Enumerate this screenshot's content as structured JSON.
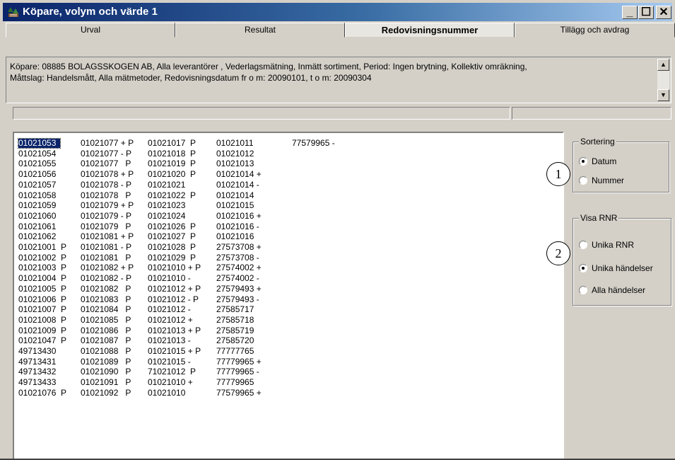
{
  "window": {
    "title": "Köpare, volym och värde 1",
    "icon": "forest-app-icon",
    "buttons": [
      {
        "name": "minimize",
        "icon": "minimize-icon",
        "glyph": "_"
      },
      {
        "name": "maximize",
        "icon": "maximize-icon",
        "glyph": "☐"
      },
      {
        "name": "close",
        "icon": "close-icon",
        "glyph": "✕"
      }
    ]
  },
  "tabs": [
    {
      "label": "Urval",
      "active": false
    },
    {
      "label": "Resultat",
      "active": false
    },
    {
      "label": "Redovisningsnummer",
      "active": true
    },
    {
      "label": "Tillägg och avdrag",
      "active": false
    }
  ],
  "info": {
    "line1": "Köpare: 08885 BOLAGSSKOGEN AB, Alla leverantörer , Vederlagsmätning, Inmätt sortiment, Period: Ingen brytning, Kollektiv omräkning,",
    "line2": "Måttslag: Handelsmått, Alla mätmetoder, Redovisningsdatum  fr o m: 20090101, t o m: 20090304"
  },
  "list": {
    "selected_index": 0,
    "rows": [
      [
        "01021053",
        "01021077 + P",
        "01021017  P",
        "01021011",
        "77579965 -"
      ],
      [
        "01021054",
        "01021077 - P",
        "01021018  P",
        "01021012",
        ""
      ],
      [
        "01021055",
        "01021077   P",
        "01021019  P",
        "01021013",
        ""
      ],
      [
        "01021056",
        "01021078 + P",
        "01021020  P",
        "01021014 +",
        ""
      ],
      [
        "01021057",
        "01021078 - P",
        "01021021",
        "01021014 -",
        ""
      ],
      [
        "01021058",
        "01021078   P",
        "01021022  P",
        "01021014",
        ""
      ],
      [
        "01021059",
        "01021079 + P",
        "01021023",
        "01021015",
        ""
      ],
      [
        "01021060",
        "01021079 - P",
        "01021024",
        "01021016 +",
        ""
      ],
      [
        "01021061",
        "01021079   P",
        "01021026  P",
        "01021016 -",
        ""
      ],
      [
        "01021062",
        "01021081 + P",
        "01021027  P",
        "01021016",
        ""
      ],
      [
        "01021001  P",
        "01021081 - P",
        "01021028  P",
        "27573708 +",
        ""
      ],
      [
        "01021002  P",
        "01021081   P",
        "01021029  P",
        "27573708 -",
        ""
      ],
      [
        "01021003  P",
        "01021082 + P",
        "01021010 + P",
        "27574002 +",
        ""
      ],
      [
        "01021004  P",
        "01021082 - P",
        "01021010 -",
        "27574002 -",
        ""
      ],
      [
        "01021005  P",
        "01021082   P",
        "01021012 + P",
        "27579493 +",
        ""
      ],
      [
        "01021006  P",
        "01021083   P",
        "01021012 - P",
        "27579493 -",
        ""
      ],
      [
        "01021007  P",
        "01021084   P",
        "01021012 -",
        "27585717",
        ""
      ],
      [
        "01021008  P",
        "01021085   P",
        "01021012 +",
        "27585718",
        ""
      ],
      [
        "01021009  P",
        "01021086   P",
        "01021013 + P",
        "27585719",
        ""
      ],
      [
        "01021047  P",
        "01021087   P",
        "01021013 -",
        "27585720",
        ""
      ],
      [
        "49713430",
        "01021088   P",
        "01021015 + P",
        "77777765",
        ""
      ],
      [
        "49713431",
        "01021089   P",
        "01021015 -",
        "77779965 +",
        ""
      ],
      [
        "49713432",
        "01021090   P",
        "71021012  P",
        "77779965 -",
        ""
      ],
      [
        "49713433",
        "01021091   P",
        "01021010 +",
        "77779965",
        ""
      ],
      [
        "01021076  P",
        "01021092   P",
        "01021010",
        "77579965 +",
        ""
      ]
    ]
  },
  "sortering": {
    "legend": "Sortering",
    "options": [
      {
        "label": "Datum",
        "checked": true
      },
      {
        "label": "Nummer",
        "checked": false
      }
    ]
  },
  "visa_rnr": {
    "legend": "Visa RNR",
    "options": [
      {
        "label": "Unika RNR",
        "checked": false
      },
      {
        "label": "Unika händelser",
        "checked": true
      },
      {
        "label": "Alla händelser",
        "checked": false
      }
    ]
  },
  "callouts": [
    "1",
    "2"
  ]
}
